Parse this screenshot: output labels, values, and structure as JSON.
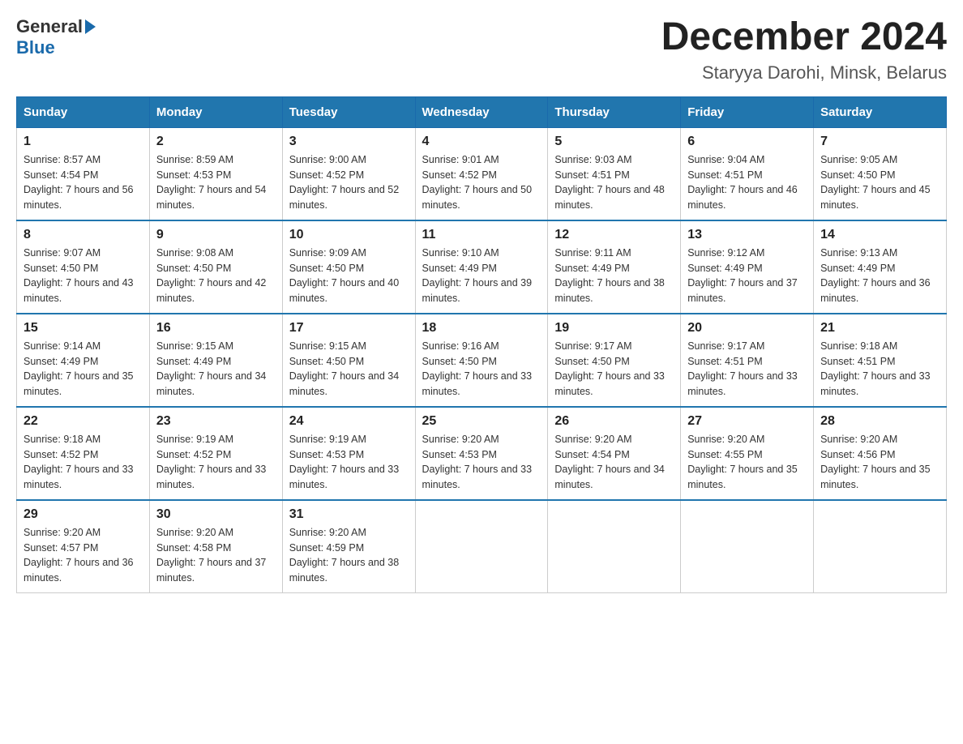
{
  "header": {
    "logo_general": "General",
    "logo_blue": "Blue",
    "month_title": "December 2024",
    "subtitle": "Staryya Darohi, Minsk, Belarus"
  },
  "days_of_week": [
    "Sunday",
    "Monday",
    "Tuesday",
    "Wednesday",
    "Thursday",
    "Friday",
    "Saturday"
  ],
  "weeks": [
    [
      {
        "day": "1",
        "sunrise": "8:57 AM",
        "sunset": "4:54 PM",
        "daylight": "7 hours and 56 minutes."
      },
      {
        "day": "2",
        "sunrise": "8:59 AM",
        "sunset": "4:53 PM",
        "daylight": "7 hours and 54 minutes."
      },
      {
        "day": "3",
        "sunrise": "9:00 AM",
        "sunset": "4:52 PM",
        "daylight": "7 hours and 52 minutes."
      },
      {
        "day": "4",
        "sunrise": "9:01 AM",
        "sunset": "4:52 PM",
        "daylight": "7 hours and 50 minutes."
      },
      {
        "day": "5",
        "sunrise": "9:03 AM",
        "sunset": "4:51 PM",
        "daylight": "7 hours and 48 minutes."
      },
      {
        "day": "6",
        "sunrise": "9:04 AM",
        "sunset": "4:51 PM",
        "daylight": "7 hours and 46 minutes."
      },
      {
        "day": "7",
        "sunrise": "9:05 AM",
        "sunset": "4:50 PM",
        "daylight": "7 hours and 45 minutes."
      }
    ],
    [
      {
        "day": "8",
        "sunrise": "9:07 AM",
        "sunset": "4:50 PM",
        "daylight": "7 hours and 43 minutes."
      },
      {
        "day": "9",
        "sunrise": "9:08 AM",
        "sunset": "4:50 PM",
        "daylight": "7 hours and 42 minutes."
      },
      {
        "day": "10",
        "sunrise": "9:09 AM",
        "sunset": "4:50 PM",
        "daylight": "7 hours and 40 minutes."
      },
      {
        "day": "11",
        "sunrise": "9:10 AM",
        "sunset": "4:49 PM",
        "daylight": "7 hours and 39 minutes."
      },
      {
        "day": "12",
        "sunrise": "9:11 AM",
        "sunset": "4:49 PM",
        "daylight": "7 hours and 38 minutes."
      },
      {
        "day": "13",
        "sunrise": "9:12 AM",
        "sunset": "4:49 PM",
        "daylight": "7 hours and 37 minutes."
      },
      {
        "day": "14",
        "sunrise": "9:13 AM",
        "sunset": "4:49 PM",
        "daylight": "7 hours and 36 minutes."
      }
    ],
    [
      {
        "day": "15",
        "sunrise": "9:14 AM",
        "sunset": "4:49 PM",
        "daylight": "7 hours and 35 minutes."
      },
      {
        "day": "16",
        "sunrise": "9:15 AM",
        "sunset": "4:49 PM",
        "daylight": "7 hours and 34 minutes."
      },
      {
        "day": "17",
        "sunrise": "9:15 AM",
        "sunset": "4:50 PM",
        "daylight": "7 hours and 34 minutes."
      },
      {
        "day": "18",
        "sunrise": "9:16 AM",
        "sunset": "4:50 PM",
        "daylight": "7 hours and 33 minutes."
      },
      {
        "day": "19",
        "sunrise": "9:17 AM",
        "sunset": "4:50 PM",
        "daylight": "7 hours and 33 minutes."
      },
      {
        "day": "20",
        "sunrise": "9:17 AM",
        "sunset": "4:51 PM",
        "daylight": "7 hours and 33 minutes."
      },
      {
        "day": "21",
        "sunrise": "9:18 AM",
        "sunset": "4:51 PM",
        "daylight": "7 hours and 33 minutes."
      }
    ],
    [
      {
        "day": "22",
        "sunrise": "9:18 AM",
        "sunset": "4:52 PM",
        "daylight": "7 hours and 33 minutes."
      },
      {
        "day": "23",
        "sunrise": "9:19 AM",
        "sunset": "4:52 PM",
        "daylight": "7 hours and 33 minutes."
      },
      {
        "day": "24",
        "sunrise": "9:19 AM",
        "sunset": "4:53 PM",
        "daylight": "7 hours and 33 minutes."
      },
      {
        "day": "25",
        "sunrise": "9:20 AM",
        "sunset": "4:53 PM",
        "daylight": "7 hours and 33 minutes."
      },
      {
        "day": "26",
        "sunrise": "9:20 AM",
        "sunset": "4:54 PM",
        "daylight": "7 hours and 34 minutes."
      },
      {
        "day": "27",
        "sunrise": "9:20 AM",
        "sunset": "4:55 PM",
        "daylight": "7 hours and 35 minutes."
      },
      {
        "day": "28",
        "sunrise": "9:20 AM",
        "sunset": "4:56 PM",
        "daylight": "7 hours and 35 minutes."
      }
    ],
    [
      {
        "day": "29",
        "sunrise": "9:20 AM",
        "sunset": "4:57 PM",
        "daylight": "7 hours and 36 minutes."
      },
      {
        "day": "30",
        "sunrise": "9:20 AM",
        "sunset": "4:58 PM",
        "daylight": "7 hours and 37 minutes."
      },
      {
        "day": "31",
        "sunrise": "9:20 AM",
        "sunset": "4:59 PM",
        "daylight": "7 hours and 38 minutes."
      },
      null,
      null,
      null,
      null
    ]
  ]
}
